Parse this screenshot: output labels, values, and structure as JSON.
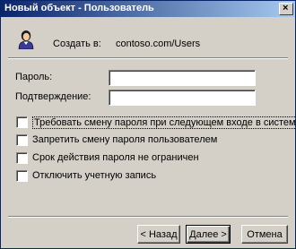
{
  "window": {
    "title": "Новый объект - Пользователь"
  },
  "header": {
    "created_label": "Создать в:",
    "created_value": "contoso.com/Users"
  },
  "fields": [
    {
      "label": "Пароль:",
      "value": ""
    },
    {
      "label": "Подтверждение:",
      "value": ""
    }
  ],
  "checkboxes": [
    {
      "label": "Требовать смену пароля при следующем входе в систему",
      "checked": false
    },
    {
      "label": "Запретить смену пароля пользователем",
      "checked": false
    },
    {
      "label": "Срок действия пароля не ограничен",
      "checked": false
    },
    {
      "label": "Отключить учетную запись",
      "checked": false
    }
  ],
  "buttons": {
    "back": "< Назад",
    "next": "Далее >",
    "cancel": "Отмена"
  },
  "icons": {
    "close": "close-icon",
    "user": "user-icon"
  }
}
